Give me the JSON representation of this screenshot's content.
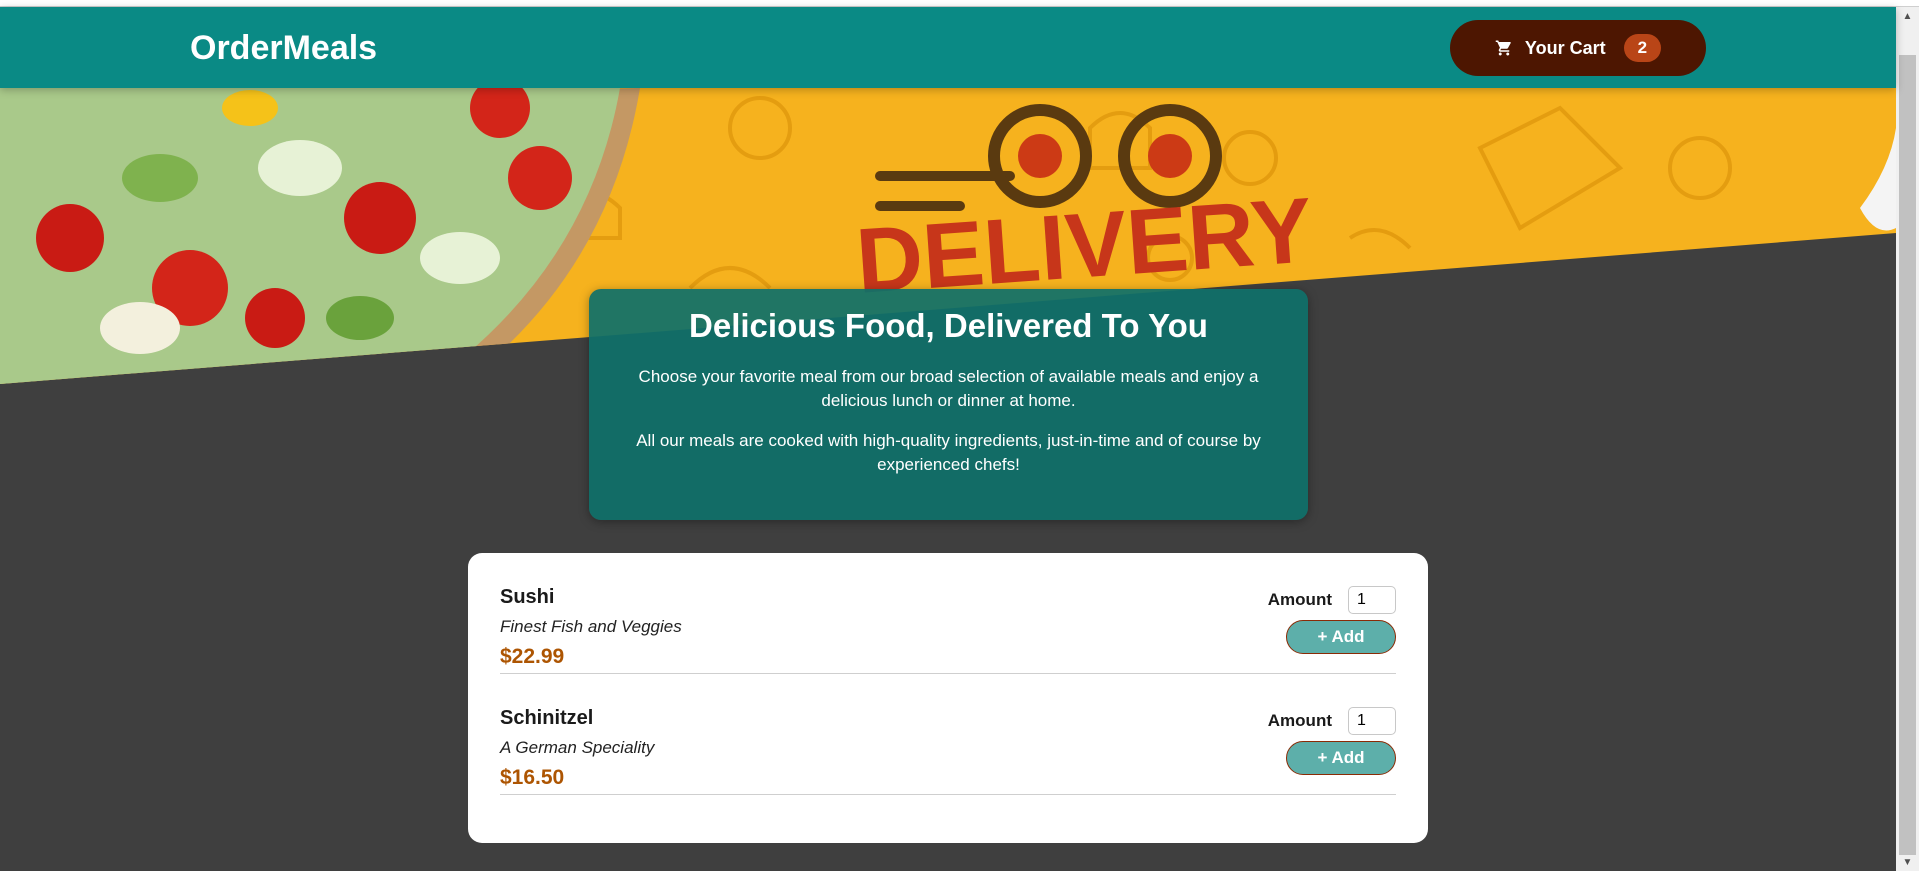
{
  "header": {
    "brand": "OrderMeals",
    "cart_label": "Your Cart",
    "cart_count": "2"
  },
  "hero": {
    "banner_text": "DELIVERY"
  },
  "summary": {
    "title": "Delicious Food, Delivered To You",
    "paragraph1": "Choose your favorite meal from our broad selection of available meals and enjoy a delicious lunch or dinner at home.",
    "paragraph2": "All our meals are cooked with high-quality ingredients, just-in-time and of course by experienced chefs!"
  },
  "meals": [
    {
      "name": "Sushi",
      "description": "Finest Fish and Veggies",
      "price": "$22.99",
      "amount_label": "Amount",
      "amount": "1",
      "add_label": "+ Add"
    },
    {
      "name": "Schinitzel",
      "description": "A German Speciality",
      "price": "$16.50",
      "amount_label": "Amount",
      "amount": "1",
      "add_label": "+ Add"
    }
  ],
  "colors": {
    "header": "#0a8a85",
    "cart_button": "#4d1601",
    "badge": "#b94517",
    "price": "#ad5502",
    "add_button": "#5dafaa",
    "background": "#3f3f3f"
  },
  "icons": {
    "cart": "cart-icon",
    "scroll_up": "arrow-up-icon",
    "scroll_down": "arrow-down-icon"
  }
}
